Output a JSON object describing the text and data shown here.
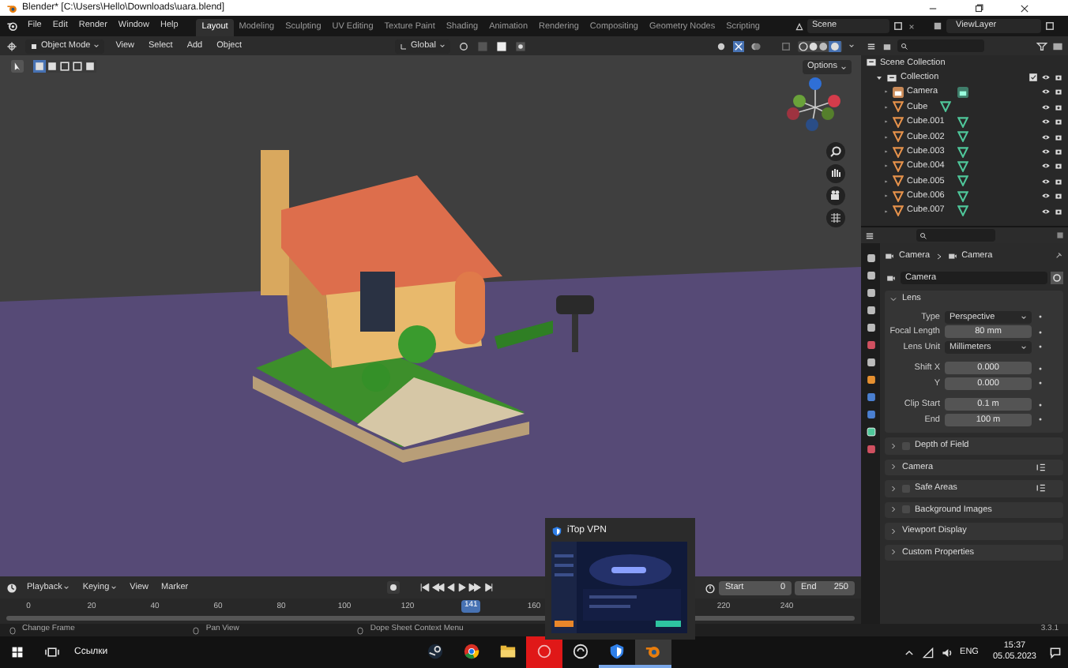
{
  "window": {
    "title": "Blender* [C:\\Users\\Hello\\Downloads\\uara.blend]"
  },
  "menu": [
    "File",
    "Edit",
    "Render",
    "Window",
    "Help"
  ],
  "workspaces": [
    {
      "label": "Layout",
      "selected": true
    },
    {
      "label": "Modeling",
      "selected": false
    },
    {
      "label": "Sculpting",
      "selected": false
    },
    {
      "label": "UV Editing",
      "selected": false
    },
    {
      "label": "Texture Paint",
      "selected": false
    },
    {
      "label": "Shading",
      "selected": false
    },
    {
      "label": "Animation",
      "selected": false
    },
    {
      "label": "Rendering",
      "selected": false
    },
    {
      "label": "Compositing",
      "selected": false
    },
    {
      "label": "Geometry Nodes",
      "selected": false
    },
    {
      "label": "Scripting",
      "selected": false
    }
  ],
  "scene": "Scene",
  "view_layer": "ViewLayer",
  "viewport_header": {
    "mode": "Object Mode",
    "menus": [
      "View",
      "Select",
      "Add",
      "Object"
    ],
    "orientation": "Global"
  },
  "viewport": {
    "options": "Options"
  },
  "outliner": {
    "root": "Scene Collection",
    "collections": [
      {
        "name": "Collection",
        "expanded": true,
        "children": [
          {
            "name": "Camera",
            "kind": "camera"
          },
          {
            "name": "Cube",
            "kind": "mesh"
          },
          {
            "name": "Cube.001",
            "kind": "mesh"
          },
          {
            "name": "Cube.002",
            "kind": "mesh"
          },
          {
            "name": "Cube.003",
            "kind": "mesh"
          },
          {
            "name": "Cube.004",
            "kind": "mesh"
          },
          {
            "name": "Cube.005",
            "kind": "mesh"
          },
          {
            "name": "Cube.006",
            "kind": "mesh"
          },
          {
            "name": "Cube.007",
            "kind": "mesh"
          }
        ]
      }
    ]
  },
  "properties": {
    "breadcrumb": [
      "Camera",
      "Camera"
    ],
    "datablock": "Camera",
    "panels": [
      {
        "label": "Lens",
        "expanded": true,
        "groups": [
          [
            {
              "label": "Type",
              "value": "Perspective",
              "kind": "dropdown"
            },
            {
              "label": "Focal Length",
              "value": "80 mm",
              "kind": "number"
            },
            {
              "label": "Lens Unit",
              "value": "Millimeters",
              "kind": "dropdown"
            }
          ],
          [
            {
              "label": "Shift X",
              "value": "0.000",
              "kind": "number"
            },
            {
              "label": "Y",
              "value": "0.000",
              "kind": "number"
            }
          ],
          [
            {
              "label": "Clip Start",
              "value": "0.1 m",
              "kind": "number"
            },
            {
              "label": "End",
              "value": "100 m",
              "kind": "number"
            }
          ]
        ]
      },
      {
        "label": "Depth of Field",
        "expanded": false,
        "checked": false
      },
      {
        "label": "Camera",
        "expanded": false,
        "presets": true
      },
      {
        "label": "Safe Areas",
        "expanded": false,
        "checked": false,
        "presets": true
      },
      {
        "label": "Background Images",
        "expanded": false,
        "checked": false
      },
      {
        "label": "Viewport Display",
        "expanded": false
      },
      {
        "label": "Custom Properties",
        "expanded": false
      }
    ]
  },
  "timeline": {
    "menus": [
      {
        "label": "Playback",
        "dropdown": true
      },
      {
        "label": "Keying",
        "dropdown": true
      },
      {
        "label": "View",
        "dropdown": false
      },
      {
        "label": "Marker",
        "dropdown": false
      }
    ],
    "start_label": "Start",
    "start": "0",
    "end_label": "End",
    "end": "250",
    "ruler": [
      "0",
      "20",
      "40",
      "60",
      "80",
      "100",
      "120",
      "160",
      "220",
      "240"
    ],
    "current_frame": "141"
  },
  "status_bar": {
    "hints": [
      "Change Frame",
      "Pan View",
      "Dope Sheet Context Menu"
    ],
    "version": "3.3.1"
  },
  "taskbar": {
    "links": "Ссылки",
    "language": "ENG",
    "time": "15:37",
    "date": "05.05.2023",
    "apps": [
      {
        "kind": "steam",
        "open": false,
        "selected": false
      },
      {
        "kind": "chrome",
        "open": false,
        "selected": false
      },
      {
        "kind": "folder",
        "open": false,
        "selected": false
      },
      {
        "kind": "red",
        "open": false,
        "selected": false
      },
      {
        "kind": "circle",
        "open": false,
        "selected": false
      },
      {
        "kind": "shield",
        "open": true,
        "selected": false
      },
      {
        "kind": "blender",
        "open": true,
        "selected": true
      }
    ]
  },
  "popup": {
    "title": "iTop VPN"
  }
}
